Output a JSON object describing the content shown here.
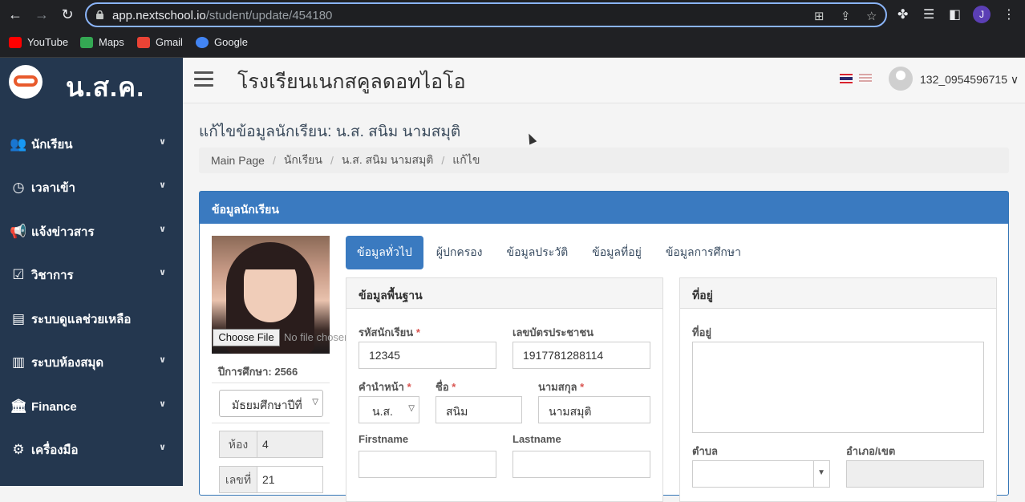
{
  "browser": {
    "url_host": "app.nextschool.io",
    "url_path": "/student/update/454180",
    "profile_initial": "J",
    "bookmarks": [
      {
        "label": "YouTube",
        "color": "#ff0000"
      },
      {
        "label": "Maps",
        "color": "#34a853"
      },
      {
        "label": "Gmail",
        "color": "#ea4335"
      },
      {
        "label": "Google",
        "color": "#4285f4"
      }
    ]
  },
  "sidebar": {
    "brand": "น.ส.ค.",
    "items": [
      {
        "label": "นักเรียน",
        "icon": "users-icon"
      },
      {
        "label": "เวลาเข้า",
        "icon": "clock-icon"
      },
      {
        "label": "แจ้งข่าวสาร",
        "icon": "megaphone-icon"
      },
      {
        "label": "วิชาการ",
        "icon": "calendar-check-icon"
      },
      {
        "label": "ระบบดูแลช่วยเหลือ",
        "icon": "id-card-icon"
      },
      {
        "label": "ระบบห้องสมุด",
        "icon": "book-icon"
      },
      {
        "label": "Finance",
        "icon": "bank-icon"
      },
      {
        "label": "เครื่องมือ",
        "icon": "chip-icon"
      }
    ]
  },
  "header": {
    "school_name": "โรงเรียนเนกสคูลดอทไอโอ",
    "username": "132_0954596715"
  },
  "page": {
    "title": "แก้ไขข้อมูลนักเรียน: น.ส. สนิม นามสมุติ",
    "breadcrumb": [
      "Main Page",
      "นักเรียน",
      "น.ส. สนิม นามสมุติ",
      "แก้ไข"
    ]
  },
  "panel": {
    "title": "ข้อมูลนักเรียน",
    "choose_file": "Choose File",
    "no_file": "No file chosen",
    "academic_year": "ปีการศึกษา: 2566",
    "grade": "มัธยมศึกษาปีที่",
    "room_label": "ห้อง",
    "room_value": "4",
    "number_label": "เลขที่",
    "number_value": "21",
    "tabs": [
      "ข้อมูลทั่วไป",
      "ผู้ปกครอง",
      "ข้อมูลประวัติ",
      "ข้อมูลที่อยู่",
      "ข้อมูลการศึกษา"
    ]
  },
  "basic": {
    "title": "ข้อมูลพื้นฐาน",
    "student_id_label": "รหัสนักเรียน",
    "student_id": "12345",
    "national_id_label": "เลขบัตรประชาชน",
    "national_id": "1917781288114",
    "prefix_label": "คำนำหน้า",
    "prefix": "น.ส.",
    "firstname_label": "ชื่อ",
    "firstname": "สนิม",
    "lastname_label": "นามสกุล",
    "lastname": "นามสมุติ",
    "firstname_en_label": "Firstname",
    "firstname_en": "",
    "lastname_en_label": "Lastname",
    "lastname_en": ""
  },
  "address": {
    "title": "ที่อยู่",
    "address_label": "ที่อยู่",
    "subdistrict_label": "ตำบล",
    "district_label": "อำเภอ/เขต"
  }
}
